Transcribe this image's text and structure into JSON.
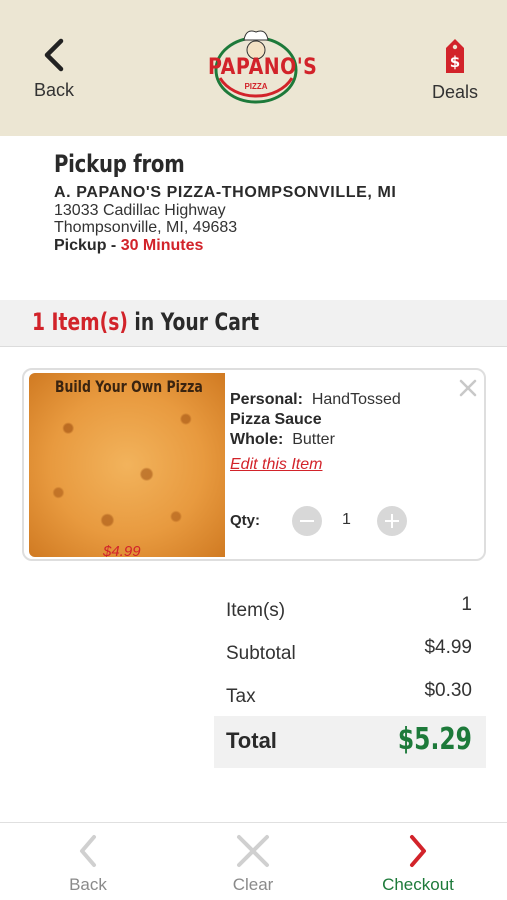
{
  "header": {
    "back_label": "Back",
    "deals_label": "Deals",
    "logo_text": "PAPANO'S",
    "logo_subtext": "PIZZA"
  },
  "pickup": {
    "title": "Pickup from",
    "store_name": "A. PAPANO'S PIZZA-THOMPSONVILLE, MI",
    "address_line1": "13033 Cadillac Highway",
    "address_line2": "Thompsonville, MI, 49683",
    "time_label": "Pickup - ",
    "time_value": "30 Minutes"
  },
  "cart": {
    "count_text": "1 Item(s)",
    "suffix_text": " in Your Cart"
  },
  "item": {
    "image_title": "Build Your Own Pizza",
    "image_price": "$4.99",
    "size_label": "Personal:",
    "size_value": "HandTossed",
    "sauce": "Pizza Sauce",
    "topping_label": "Whole:",
    "topping_value": "Butter",
    "edit_label": "Edit this Item",
    "qty_label": "Qty:",
    "qty_value": "1"
  },
  "summary": {
    "items_label": "Item(s)",
    "items_value": "1",
    "subtotal_label": "Subtotal",
    "subtotal_value": "$4.99",
    "tax_label": "Tax",
    "tax_value": "$0.30",
    "total_label": "Total",
    "total_value": "$5.29"
  },
  "bottom_bar": {
    "back_label": "Back",
    "clear_label": "Clear",
    "checkout_label": "Checkout"
  },
  "colors": {
    "brand_red": "#d2232a",
    "total_green": "#1d7a3a",
    "header_bg": "#ece6d3"
  },
  "icons": {
    "header_back": "chevron-left-icon",
    "deals": "price-tag-icon",
    "remove_item": "close-icon",
    "bottom_back": "chevron-left-icon",
    "bottom_clear": "close-icon",
    "bottom_checkout": "chevron-right-icon"
  }
}
